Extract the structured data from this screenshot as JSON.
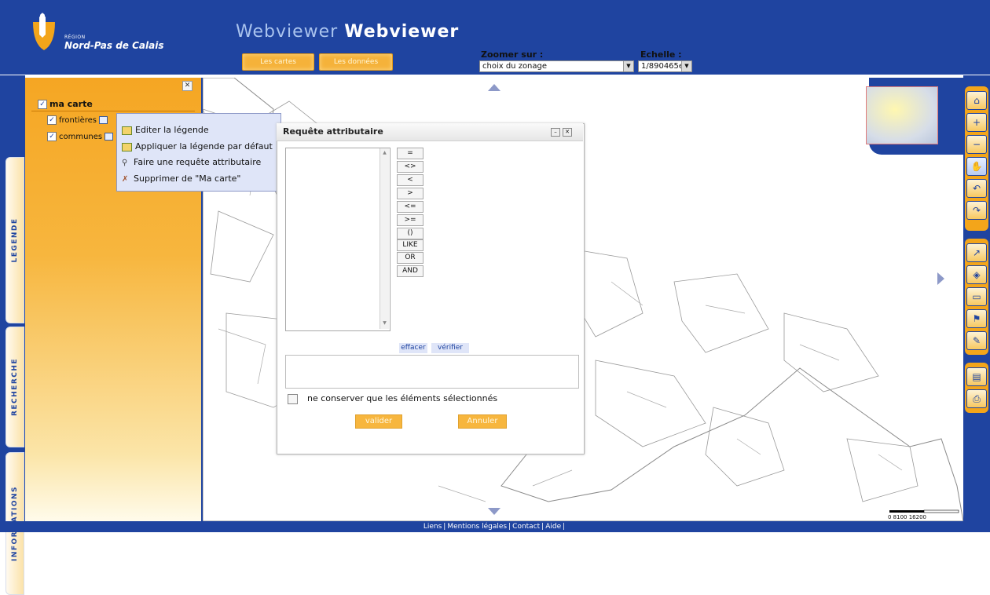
{
  "header": {
    "logo_region": "RÉGION",
    "logo_name": "Nord-Pas de Calais",
    "title_a": "Webviewer",
    "title_b": "Webviewer",
    "btn_cartes": "Les cartes",
    "btn_donnees": "Les données",
    "zoom_label": "Zoomer sur :",
    "zoom_value": "choix du zonage",
    "echelle_label": "Echelle :",
    "echelle_value": "1/890465e"
  },
  "left_tabs": [
    "LEGENDE",
    "RECHERCHE",
    "INFORMATIONS"
  ],
  "legend": {
    "root_label": "ma carte",
    "layers": [
      {
        "label": "frontières",
        "checked": true
      },
      {
        "label": "communes",
        "checked": true
      }
    ]
  },
  "context_menu": [
    {
      "label": "Editer la légende",
      "icon": "legend-edit-icon"
    },
    {
      "label": "Appliquer la légende par défaut",
      "icon": "legend-default-icon"
    },
    {
      "label": "Faire une requête attributaire",
      "icon": "search-icon"
    },
    {
      "label": "Supprimer de \"Ma carte\"",
      "icon": "delete-icon"
    }
  ],
  "dialog": {
    "title": "Requête attributaire",
    "operators": [
      "=",
      "<>",
      "<",
      ">",
      "<=",
      ">=",
      "()",
      "LIKE",
      "OR",
      "AND"
    ],
    "effacer": "effacer",
    "verifier": "vérifier",
    "keep_label": "ne conserver que les éléments sélectionnés",
    "valider": "valider",
    "annuler": "Annuler"
  },
  "scale": {
    "label": "0   8100  16200"
  },
  "toolbar": {
    "groups": [
      [
        "full-extent-icon",
        "zoom-in-icon",
        "zoom-out-icon",
        "pan-hand-icon",
        "zoom-previous-icon",
        "zoom-next-icon"
      ],
      [
        "identify-icon",
        "tag-icon",
        "measure-icon",
        "draw-icon",
        "pencil-icon"
      ],
      [
        "print-icon",
        "export-icon"
      ]
    ]
  },
  "footer": {
    "links": [
      "Liens",
      "Mentions légales",
      "Contact",
      "Aide"
    ]
  },
  "colors": {
    "blue": "#1f44a0",
    "orange": "#f3a51a",
    "menu_bg": "#dfe5f8"
  }
}
